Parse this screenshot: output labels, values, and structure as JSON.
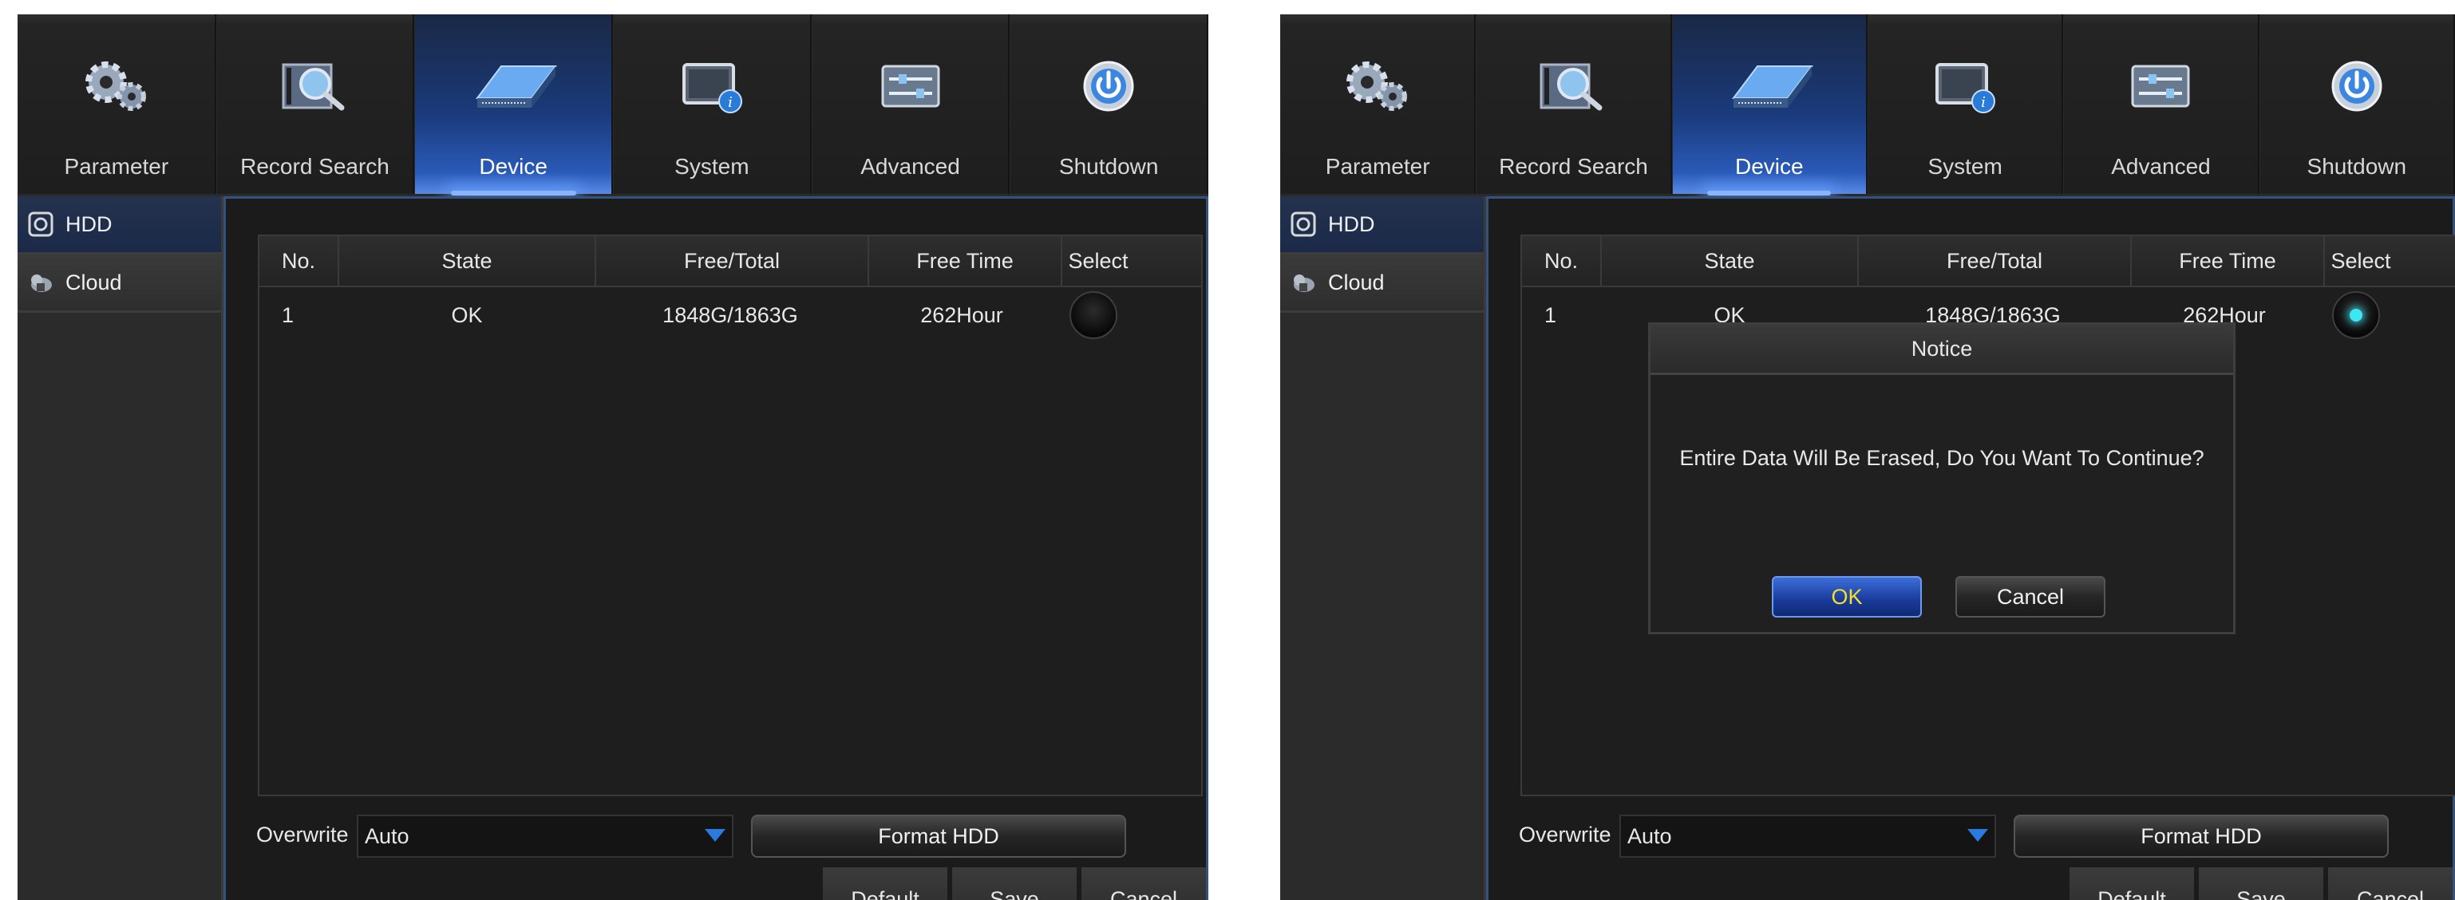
{
  "nav": {
    "items": [
      {
        "label": "Parameter",
        "icon": "gears-icon"
      },
      {
        "label": "Record Search",
        "icon": "film-search-icon"
      },
      {
        "label": "Device",
        "icon": "hdd-icon",
        "active": true
      },
      {
        "label": "System",
        "icon": "system-info-icon"
      },
      {
        "label": "Advanced",
        "icon": "advanced-settings-icon"
      },
      {
        "label": "Shutdown",
        "icon": "power-icon"
      }
    ]
  },
  "sidebar": {
    "items": [
      {
        "label": "HDD",
        "icon": "hdd-small-icon",
        "active": true
      },
      {
        "label": "Cloud",
        "icon": "cloud-icon"
      }
    ]
  },
  "table": {
    "headers": [
      "No.",
      "State",
      "Free/Total",
      "Free Time",
      "Select"
    ],
    "rows": [
      {
        "no": "1",
        "state": "OK",
        "free_total": "1848G/1863G",
        "free_time": "262Hour"
      }
    ]
  },
  "overwrite": {
    "label": "Overwrite",
    "value": "Auto"
  },
  "format_button": "Format HDD",
  "footer": {
    "default": "Default",
    "save": "Save",
    "cancel": "Cancel"
  },
  "dialog": {
    "title": "Notice",
    "message": "Entire Data Will Be Erased, Do You Want To Continue?",
    "ok": "OK",
    "cancel": "Cancel"
  },
  "panels": {
    "left": {
      "select_checked": false,
      "dialog_visible": false
    },
    "right": {
      "select_checked": true,
      "dialog_visible": true
    }
  },
  "colors": {
    "active_tab": "#2a5ab8",
    "radio_selected": "#3ce6f2",
    "ok_text": "#f2e02a",
    "panel_bg": "#1b1b1b"
  }
}
